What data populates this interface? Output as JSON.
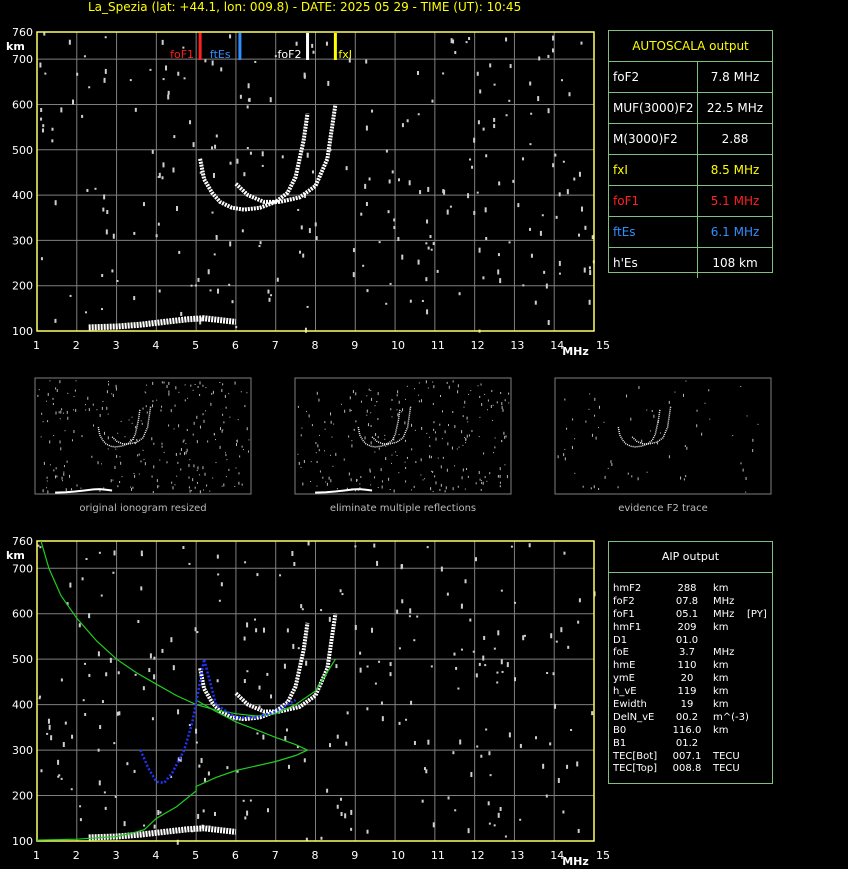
{
  "header": {
    "title": "La_Spezia (lat: +44.1, lon: 009.8) - DATE: 2025 05 29 - TIME (UT): 10:45"
  },
  "colors": {
    "foF1": "#ff2020",
    "ftEs": "#2f8fff",
    "foF2": "#ffffff",
    "fxI": "#ffff00",
    "frame": "#ffff66",
    "grid": "#7f7f7f",
    "profile": "#22cc22",
    "aip_trace": "#2233ff"
  },
  "chart_data": [
    {
      "type": "scatter",
      "name": "ionogram",
      "xlabel": "MHz",
      "ylabel": "km",
      "xlim": [
        1,
        15
      ],
      "ylim": [
        100,
        760
      ],
      "x_ticks": [
        1,
        2,
        3,
        4,
        5,
        6,
        7,
        8,
        9,
        10,
        11,
        12,
        13,
        14,
        15
      ],
      "y_ticks": [
        100,
        200,
        300,
        400,
        500,
        600,
        700,
        760
      ],
      "grid": true,
      "markers": [
        {
          "label": "foF1",
          "x": 5.1
        },
        {
          "label": "ftEs",
          "x": 6.1
        },
        {
          "label": "foF2",
          "x": 7.8
        },
        {
          "label": "fxI",
          "x": 8.5
        }
      ],
      "traces": {
        "o_trace": [
          [
            5.1,
            480
          ],
          [
            5.2,
            435
          ],
          [
            5.4,
            405
          ],
          [
            5.6,
            385
          ],
          [
            5.9,
            372
          ],
          [
            6.2,
            368
          ],
          [
            6.6,
            372
          ],
          [
            7.0,
            385
          ],
          [
            7.3,
            405
          ],
          [
            7.5,
            440
          ],
          [
            7.7,
            520
          ],
          [
            7.8,
            580
          ]
        ],
        "x_trace": [
          [
            6.0,
            425
          ],
          [
            6.3,
            400
          ],
          [
            6.7,
            385
          ],
          [
            7.1,
            385
          ],
          [
            7.6,
            395
          ],
          [
            8.0,
            420
          ],
          [
            8.3,
            480
          ],
          [
            8.5,
            600
          ]
        ],
        "es_trace": [
          [
            2.3,
            108
          ],
          [
            3.0,
            110
          ],
          [
            3.6,
            114
          ],
          [
            4.2,
            120
          ],
          [
            4.8,
            126
          ],
          [
            5.2,
            128
          ],
          [
            5.6,
            124
          ],
          [
            6.0,
            120
          ]
        ]
      }
    },
    {
      "type": "line",
      "name": "aip",
      "xlabel": "MHz",
      "ylabel": "km",
      "xlim": [
        1,
        15
      ],
      "ylim": [
        100,
        760
      ],
      "x_ticks": [
        1,
        2,
        3,
        4,
        5,
        6,
        7,
        8,
        9,
        10,
        11,
        12,
        13,
        14,
        15
      ],
      "y_ticks": [
        100,
        200,
        300,
        400,
        500,
        600,
        700,
        760
      ],
      "grid": true,
      "series": [
        {
          "values": [
            [
              1.1,
              760
            ],
            [
              1.3,
              700
            ],
            [
              1.6,
              640
            ],
            [
              2.0,
              590
            ],
            [
              2.5,
              540
            ],
            [
              3.0,
              500
            ],
            [
              3.5,
              470
            ],
            [
              4.0,
              445
            ],
            [
              4.5,
              420
            ],
            [
              5.0,
              400
            ],
            [
              5.5,
              388
            ],
            [
              6.0,
              380
            ],
            [
              6.5,
              375
            ],
            [
              7.0,
              380
            ],
            [
              7.5,
              400
            ],
            [
              8.0,
              430
            ],
            [
              8.5,
              500
            ]
          ]
        },
        {
          "values": [
            [
              1.0,
              102
            ],
            [
              2.0,
              104
            ],
            [
              3.0,
              110
            ],
            [
              3.5,
              120
            ],
            [
              3.7,
              125
            ],
            [
              4.0,
              150
            ],
            [
              4.5,
              175
            ],
            [
              5.0,
              210
            ],
            [
              5.0,
              220
            ],
            [
              5.5,
              240
            ],
            [
              6.0,
              255
            ],
            [
              6.5,
              265
            ],
            [
              7.0,
              275
            ],
            [
              7.5,
              288
            ],
            [
              7.8,
              300
            ],
            [
              7.5,
              312
            ],
            [
              7.0,
              328
            ],
            [
              6.5,
              345
            ],
            [
              6.0,
              362
            ],
            [
              5.5,
              385
            ],
            [
              5.0,
              410
            ]
          ]
        },
        {
          "values": [
            [
              3.6,
              300
            ],
            [
              3.8,
              260
            ],
            [
              4.0,
              230
            ],
            [
              4.2,
              228
            ],
            [
              4.4,
              250
            ],
            [
              4.7,
              300
            ],
            [
              4.9,
              360
            ],
            [
              5.1,
              450
            ],
            [
              5.2,
              500
            ],
            [
              5.5,
              400
            ],
            [
              6.0,
              372
            ],
            [
              6.5,
              372
            ],
            [
              7.0,
              385
            ],
            [
              7.5,
              410
            ]
          ]
        }
      ]
    }
  ],
  "thumbnails": [
    {
      "caption": "original ionogram resized"
    },
    {
      "caption": "eliminate multiple reflections"
    },
    {
      "caption": "evidence F2 trace"
    }
  ],
  "autoscala": {
    "title": "AUTOSCALA output",
    "rows": [
      {
        "key": "foF2",
        "value": "7.8 MHz",
        "color": "#ffffff"
      },
      {
        "key": "MUF(3000)F2",
        "value": "22.5 MHz",
        "color": "#ffffff"
      },
      {
        "key": "M(3000)F2",
        "value": "2.88",
        "color": "#ffffff"
      },
      {
        "key": "fxI",
        "value": "8.5 MHz",
        "color": "#ffff00"
      },
      {
        "key": "foF1",
        "value": "5.1 MHz",
        "color": "#ff2020"
      },
      {
        "key": "ftEs",
        "value": "6.1 MHz",
        "color": "#2f8fff"
      },
      {
        "key": "h'Es",
        "value": "108     km",
        "color": "#ffffff"
      }
    ]
  },
  "aip": {
    "title": "AIP output",
    "rows": [
      {
        "k": "hmF2",
        "v": "288",
        "u": "km",
        "e": ""
      },
      {
        "k": "foF2",
        "v": "07.8",
        "u": "MHz",
        "e": ""
      },
      {
        "k": "foF1",
        "v": "05.1",
        "u": "MHz",
        "e": "[PY]"
      },
      {
        "k": "hmF1",
        "v": "209",
        "u": "km",
        "e": ""
      },
      {
        "k": "D1",
        "v": "01.0",
        "u": "",
        "e": ""
      },
      {
        "k": "foE",
        "v": "3.7",
        "u": "MHz",
        "e": ""
      },
      {
        "k": "hmE",
        "v": "110",
        "u": "km",
        "e": ""
      },
      {
        "k": "ymE",
        "v": "20",
        "u": "km",
        "e": ""
      },
      {
        "k": "h_vE",
        "v": "119",
        "u": "km",
        "e": ""
      },
      {
        "k": "Ewidth",
        "v": "19",
        "u": "km",
        "e": ""
      },
      {
        "k": "DelN_vE",
        "v": "00.2",
        "u": "m^(-3)",
        "e": ""
      },
      {
        "k": "B0",
        "v": "116.0",
        "u": "km",
        "e": ""
      },
      {
        "k": "B1",
        "v": "01.2",
        "u": "",
        "e": ""
      },
      {
        "k": "TEC[Bot]",
        "v": "007.1",
        "u": "TECU",
        "e": ""
      },
      {
        "k": "TEC[Top]",
        "v": "008.8",
        "u": "TECU",
        "e": ""
      }
    ]
  }
}
